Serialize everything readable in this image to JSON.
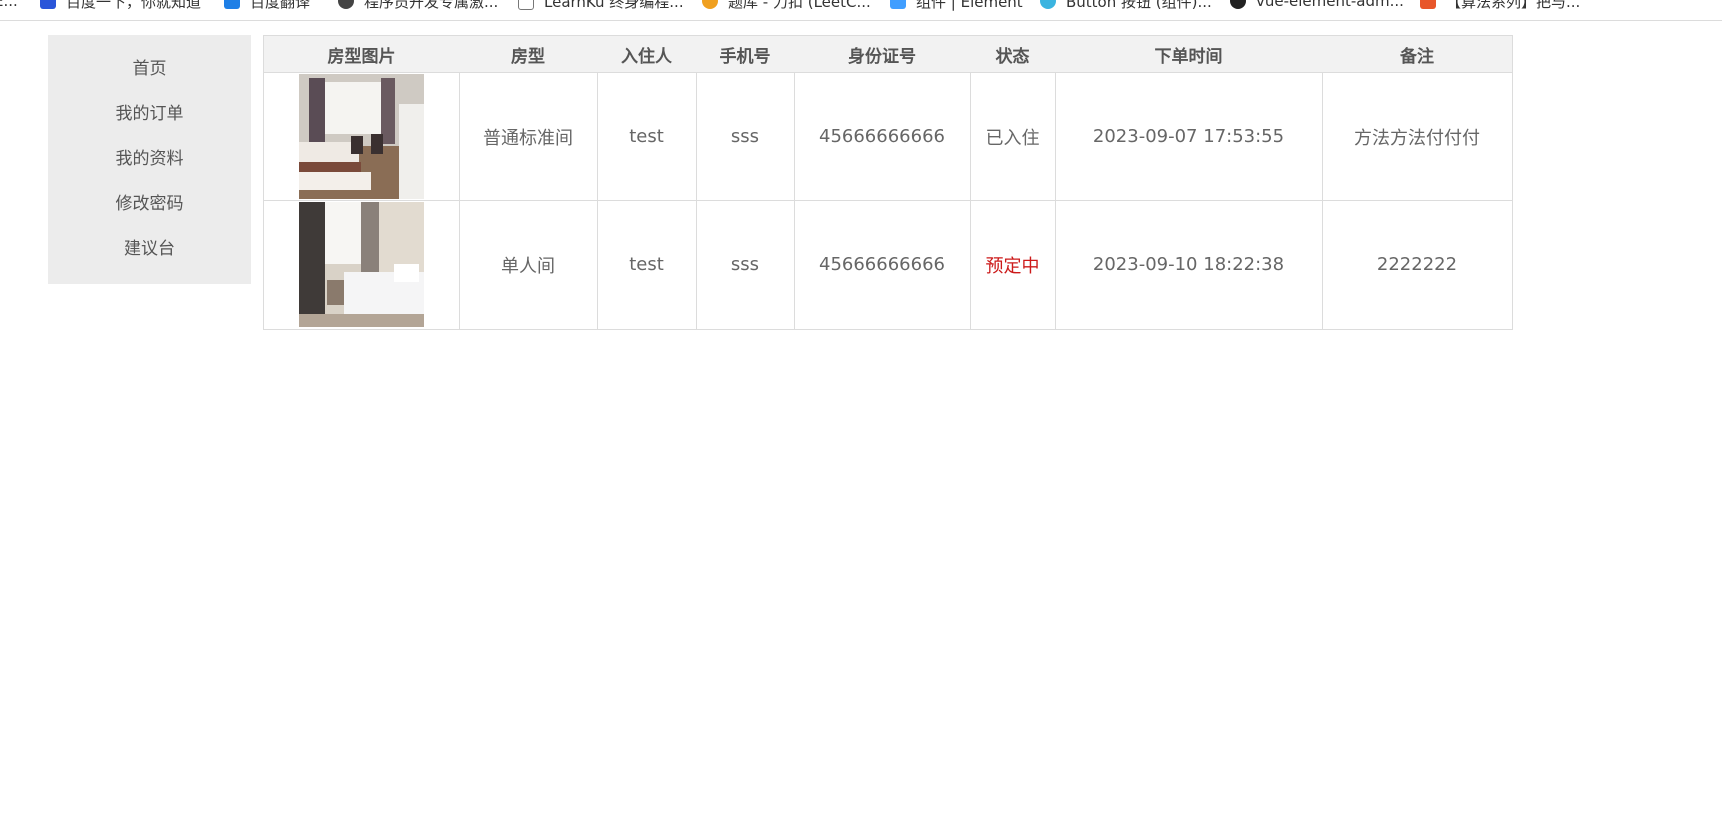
{
  "bookmarks": [
    {
      "label": "E...",
      "icon": "generic-icon"
    },
    {
      "label": "百度一下，你就知道",
      "icon": "baidu-icon"
    },
    {
      "label": "百度翻译",
      "icon": "translate-icon"
    },
    {
      "label": "程序员开发专属激...",
      "icon": "dev-icon"
    },
    {
      "label": "LearnKu 终身编程...",
      "icon": "learnku-icon"
    },
    {
      "label": "题库 - 力扣 (LeetC...",
      "icon": "leetcode-icon"
    },
    {
      "label": "组件 | Element",
      "icon": "element-icon"
    },
    {
      "label": "Button 按钮 (组件)...",
      "icon": "button-icon"
    },
    {
      "label": "vue-element-adm...",
      "icon": "github-icon"
    },
    {
      "label": "【算法系列】把与...",
      "icon": "csdn-icon"
    }
  ],
  "sidebar": {
    "items": [
      {
        "label": "首页"
      },
      {
        "label": "我的订单"
      },
      {
        "label": "我的资料"
      },
      {
        "label": "修改密码"
      },
      {
        "label": "建议台"
      }
    ]
  },
  "table": {
    "headers": [
      "房型图片",
      "房型",
      "入住人",
      "手机号",
      "身份证号",
      "状态",
      "下单时间",
      "备注"
    ],
    "rows": [
      {
        "room_type": "普通标准间",
        "guest": "test",
        "phone": "sss",
        "id_number": "45666666666",
        "status": "已入住",
        "order_time": "2023-09-07 17:53:55",
        "note": "方法方法付付付"
      },
      {
        "room_type": "单人间",
        "guest": "test",
        "phone": "sss",
        "id_number": "45666666666",
        "status": "预定中",
        "order_time": "2023-09-10 18:22:38",
        "note": "2222222"
      }
    ]
  },
  "colors": {
    "status_reserved": "#cc1a1a",
    "sidebar_bg": "#ececec",
    "header_bg": "#f2f2f2",
    "border": "#dcdcdc"
  }
}
